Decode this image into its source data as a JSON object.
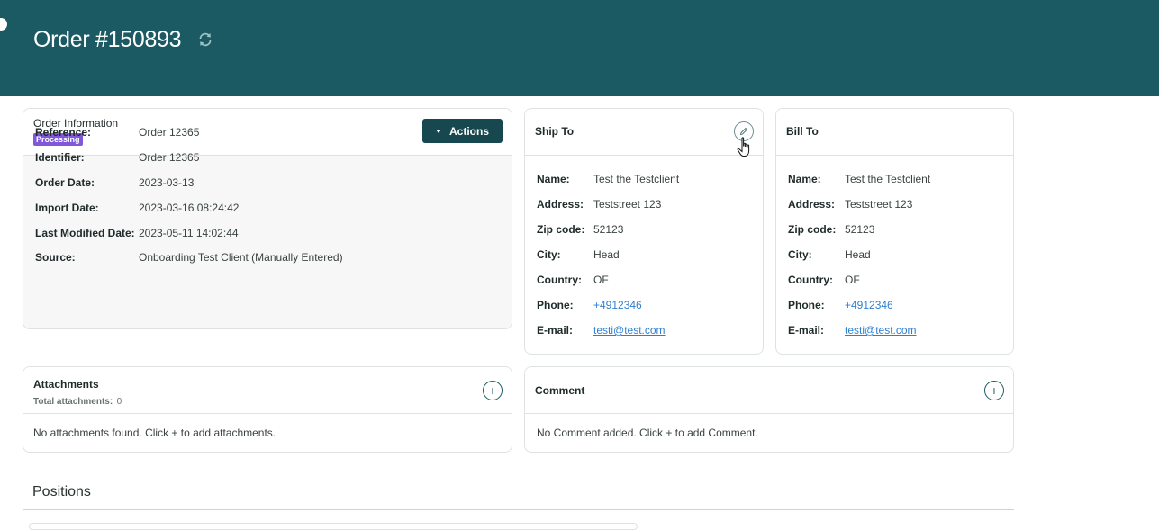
{
  "header": {
    "title": "Order #150893",
    "refresh_icon": "refresh-icon"
  },
  "order_info": {
    "title": "Order Information",
    "status_badge": "Processing",
    "actions_label": "Actions",
    "fields": [
      {
        "label": "Reference:",
        "value": "Order 12365"
      },
      {
        "label": "Identifier:",
        "value": "Order 12365"
      },
      {
        "label": "Order Date:",
        "value": "2023-03-13"
      },
      {
        "label": "Import Date:",
        "value": "2023-03-16 08:24:42"
      },
      {
        "label": "Last Modified Date:",
        "value": "2023-05-11 14:02:44"
      },
      {
        "label": "Source:",
        "value": "Onboarding Test Client (Manually Entered)"
      }
    ]
  },
  "ship_to": {
    "title": "Ship To",
    "edit_icon": "pencil-icon",
    "fields": [
      {
        "label": "Name:",
        "value": "Test the Testclient"
      },
      {
        "label": "Address:",
        "value": "Teststreet 123"
      },
      {
        "label": "Zip code:",
        "value": "52123"
      },
      {
        "label": "City:",
        "value": "Head"
      },
      {
        "label": "Country:",
        "value": "OF"
      },
      {
        "label": "Phone:",
        "value": "+4912346"
      },
      {
        "label": "E-mail:",
        "value": "testi@test.com"
      }
    ]
  },
  "bill_to": {
    "title": "Bill To",
    "fields": [
      {
        "label": "Name:",
        "value": "Test the Testclient"
      },
      {
        "label": "Address:",
        "value": "Teststreet 123"
      },
      {
        "label": "Zip code:",
        "value": "52123"
      },
      {
        "label": "City:",
        "value": "Head"
      },
      {
        "label": "Country:",
        "value": "OF"
      },
      {
        "label": "Phone:",
        "value": "+4912346"
      },
      {
        "label": "E-mail:",
        "value": "testi@test.com"
      }
    ]
  },
  "attachments": {
    "title": "Attachments",
    "total_label": "Total attachments:",
    "total_count": "0",
    "empty_text": "No attachments found. Click + to add attachments."
  },
  "comment": {
    "title": "Comment",
    "empty_text": "No Comment added. Click + to add Comment."
  },
  "positions": {
    "title": "Positions"
  },
  "colors": {
    "header_bg": "#1b5a63",
    "badge_bg": "#8058d9",
    "action_btn_bg": "#17484f",
    "link": "#2f7fd1"
  }
}
